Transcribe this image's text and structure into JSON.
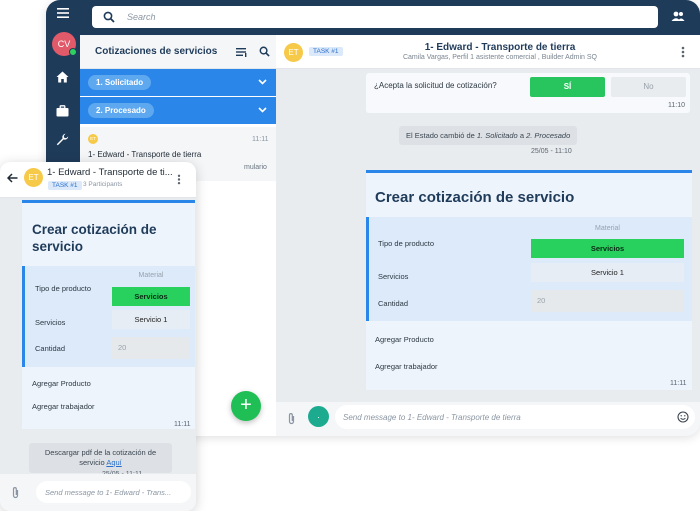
{
  "search": {
    "placeholder": "Search"
  },
  "user": {
    "initials": "CV"
  },
  "list": {
    "title": "Cotizaciones de servicios",
    "groups": [
      {
        "label": "1. Solicitado"
      },
      {
        "label": "2. Procesado"
      }
    ],
    "item": {
      "avatar": "ET",
      "time": "11:11",
      "title": "1- Edward - Transporte de tierra",
      "preview": "mulario"
    }
  },
  "chat": {
    "avatar": "ET",
    "tag": "TASK #1",
    "title": "1- Edward - Transporte de tierra",
    "subtitle": "Camila Vargas, Perfil 1 asistente comercial , Builder Admin SQ",
    "question": "¿Acepta la solicitud de cotización?",
    "yes": "SÍ",
    "no": "No",
    "time1": "11:10",
    "status_prefix": "El Estado cambió de ",
    "status_from": "1. Solicitado",
    "status_mid": " a ",
    "status_to": "2. Procesado",
    "status_time": "25/05 - 11:10",
    "form": {
      "title": "Crear cotización de servicio",
      "col_header": "Material",
      "tipo_label": "Tipo de producto",
      "tipo_value": "Servicios",
      "servicios_label": "Servicios",
      "servicios_value": "Servicio 1",
      "cantidad_label": "Cantidad",
      "cantidad_value": "20",
      "add_product": "Agregar Producto",
      "add_worker": "Agregar trabajador",
      "time": "11:11"
    },
    "composer_placeholder": "Send message to 1- Edward - Transporte de tierra"
  },
  "mobile": {
    "title": "1- Edward - Transporte de ti...",
    "tag": "TASK #1",
    "participants": "3 Participants",
    "avatar": "ET",
    "form": {
      "title": "Crear cotización de servicio",
      "col_header": "Material",
      "tipo_label": "Tipo de producto",
      "tipo_value": "Servicios",
      "servicios_label": "Servicios",
      "servicios_value": "Servicio 1",
      "cantidad_label": "Cantidad",
      "cantidad_value": "20",
      "add_product": "Agregar Producto",
      "add_worker": "Agregar trabajador",
      "time": "11:11"
    },
    "download_text": "Descargar pdf de la cotización de servicio ",
    "download_link": "Aquí",
    "download_time": "25/05 - 11:11",
    "composer_placeholder": "Send message to 1- Edward - Trans..."
  },
  "colors": {
    "navy": "#1f3b5a",
    "blue": "#2a86e8",
    "green": "#28c55e",
    "avatar_yellow": "#f7c948",
    "avatar_red": "#e05a6a"
  }
}
